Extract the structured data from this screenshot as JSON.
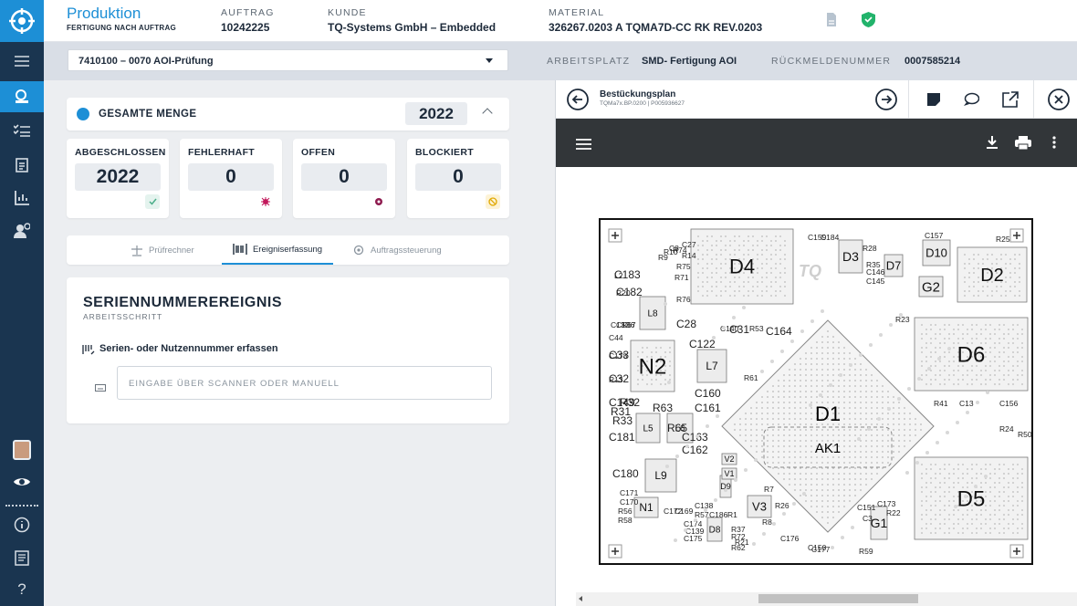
{
  "header": {
    "page_title": "Produktion",
    "page_subtitle": "FERTIGUNG NACH AUFTRAG",
    "auftrag_label": "AUFTRAG",
    "auftrag_value": "10242225",
    "kunde_label": "KUNDE",
    "kunde_value": "TQ-Systems GmbH – Embedded",
    "material_label": "MATERIAL",
    "material_value": "326267.0203 A TQMA7D-CC RK REV.0203",
    "icons": [
      "document-icon",
      "shield-check-icon"
    ]
  },
  "subbar": {
    "operation_select": "7410100 – 0070 AOI-Prüfung",
    "arbeitsplatz_label": "ARBEITSPLATZ",
    "arbeitsplatz_value": "SMD- Fertigung AOI",
    "rueckmelde_label": "RÜCKMELDENUMMER",
    "rueckmelde_value": "0007585214"
  },
  "gesamte_menge": {
    "label": "GESAMTE MENGE",
    "value": "2022"
  },
  "stats": [
    {
      "label": "ABGESCHLOSSEN",
      "value": "2022",
      "icon": "check-icon",
      "color": "#4caf8a",
      "bg": "#e4f3ee"
    },
    {
      "label": "FEHLERHAFT",
      "value": "0",
      "icon": "bug-icon",
      "color": "#c2185b",
      "bg": "#ffffff"
    },
    {
      "label": "OFFEN",
      "value": "0",
      "icon": "circle-dot-icon",
      "color": "#8e1b4f",
      "bg": "#ffffff"
    },
    {
      "label": "BLOCKIERT",
      "value": "0",
      "icon": "blocked-icon",
      "color": "#e0a800",
      "bg": "#fdf3d6"
    }
  ],
  "tabs": [
    {
      "label": "Prüfrechner",
      "icon": "scale-icon"
    },
    {
      "label": "Ereigniserfassung",
      "icon": "barcode-icon"
    },
    {
      "label": "Auftragssteuerung",
      "icon": "gear-icon"
    }
  ],
  "serial": {
    "title": "SERIENNUMMEREREIGNIS",
    "subtitle": "ARBEITSSCHRITT",
    "field_label": "Serien- oder Nutzennummer erfassen",
    "input_placeholder": "EINGABE ÜBER SCANNER ODER MANUELL"
  },
  "viewer": {
    "title": "Bestückungsplan",
    "subtitle": "TQMa7x.BP.0200 | P005936627"
  },
  "pcb": {
    "labels_big": [
      "D4",
      "D1",
      "AK1",
      "N2",
      "D6",
      "D5",
      "D2",
      "D3",
      "D10",
      "G2",
      "D7",
      "L8",
      "L7",
      "L5",
      "L6",
      "L9",
      "N1",
      "V3",
      "G1",
      "D8",
      "D9",
      "V2",
      "V1"
    ],
    "labels_small": [
      "C183",
      "C182",
      "C33",
      "C32",
      "C149",
      "R31",
      "R33",
      "C181",
      "C180",
      "C160",
      "C161",
      "C163",
      "C162",
      "R63",
      "R32",
      "R65",
      "C28",
      "C122",
      "C31",
      "C164",
      "R53",
      "C140",
      "C172",
      "C169",
      "C171",
      "C170",
      "R56",
      "R58",
      "C174",
      "C175",
      "C139",
      "C138",
      "R57",
      "C186",
      "R1",
      "R37",
      "R72",
      "R21",
      "R62",
      "R8",
      "R7",
      "R26",
      "C176",
      "C177",
      "R59",
      "C173",
      "R22",
      "R41",
      "C13",
      "C156",
      "R24",
      "R50",
      "R23",
      "C157",
      "R25",
      "C159",
      "C184",
      "R28",
      "R35",
      "C146",
      "C145",
      "R74",
      "R75",
      "R76",
      "R9",
      "R10",
      "R14",
      "C8",
      "C27",
      "C44",
      "C137",
      "C136",
      "R67",
      "R61",
      "C150",
      "C151",
      "C3",
      "R71",
      "L2",
      "R20",
      "C178",
      "R13"
    ]
  }
}
